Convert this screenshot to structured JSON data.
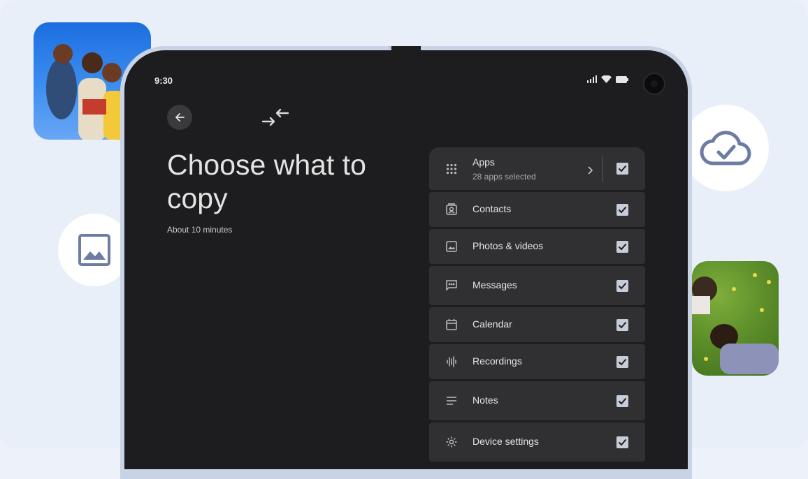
{
  "status": {
    "time": "9:30"
  },
  "header": {
    "title": "Choose what to copy",
    "subtitle": "About 10 minutes"
  },
  "items": [
    {
      "label": "Apps",
      "sublabel": "28 apps selected",
      "icon": "apps-grid-icon",
      "checked": true
    },
    {
      "label": "Contacts",
      "icon": "contacts-icon",
      "checked": true
    },
    {
      "label": "Photos & videos",
      "icon": "photo-icon",
      "checked": true
    },
    {
      "label": "Messages",
      "icon": "message-icon",
      "checked": true
    },
    {
      "label": "Calendar",
      "icon": "calendar-icon",
      "checked": true
    },
    {
      "label": "Recordings",
      "icon": "waveform-icon",
      "checked": true
    },
    {
      "label": "Notes",
      "icon": "notes-icon",
      "checked": true
    },
    {
      "label": "Device settings",
      "icon": "gear-icon",
      "checked": true
    }
  ],
  "colors": {
    "accent_icon": "#6d7ca3",
    "screen_bg": "#1d1d1f",
    "row_bg": "#303033",
    "check_bg": "#c7cdd8"
  }
}
